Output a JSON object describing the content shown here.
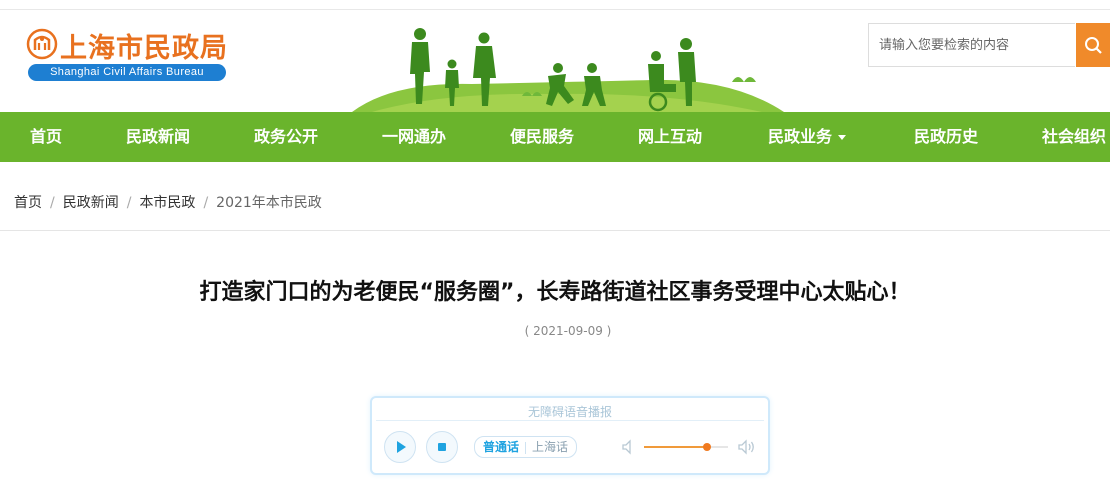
{
  "logo": {
    "cn": "上海市民政局",
    "en": "Shanghai Civil Affairs Bureau"
  },
  "search": {
    "placeholder": "请输入您要检索的内容"
  },
  "nav": {
    "items": [
      {
        "label": "首页"
      },
      {
        "label": "民政新闻"
      },
      {
        "label": "政务公开"
      },
      {
        "label": "一网通办"
      },
      {
        "label": "便民服务"
      },
      {
        "label": "网上互动"
      },
      {
        "label": "民政业务"
      },
      {
        "label": "民政历史"
      },
      {
        "label": "社会组织"
      }
    ]
  },
  "breadcrumb": {
    "items": [
      "首页",
      "民政新闻",
      "本市民政",
      "2021年本市民政"
    ]
  },
  "article": {
    "title": "打造家门口的为老便民“服务圈”，长寿路街道社区事务受理中心太贴心！",
    "date": "( 2021-09-09 )"
  },
  "player": {
    "title": "无障碍语音播报",
    "lang_mandarin": "普通话",
    "lang_shanghai": "上海话",
    "volume": 0.75
  },
  "colors": {
    "nav_green": "#6ab42c",
    "brand_orange": "#e8711f",
    "brand_blue": "#1e7fd2",
    "search_button": "#f08a2a"
  }
}
